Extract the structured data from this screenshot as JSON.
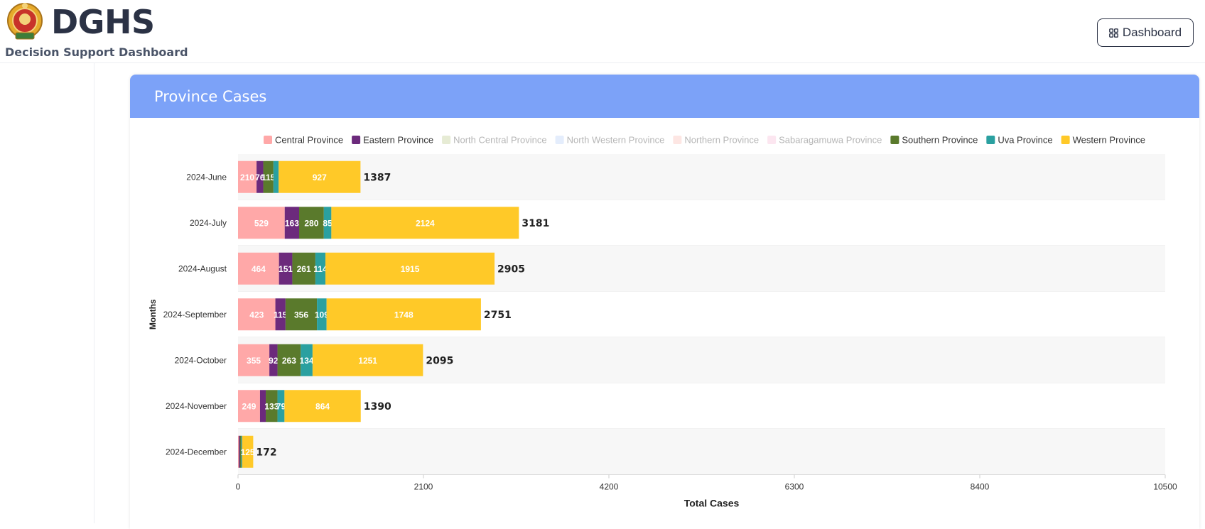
{
  "header": {
    "title": "DGHS",
    "subtitle": "Decision Support Dashboard",
    "dashboard_button": "Dashboard",
    "dashboard_icon": "grid-icon",
    "logo_icon": "emblem-logo"
  },
  "card": {
    "title": "Province Cases",
    "header_color": "#7ca2f8"
  },
  "chart_data": {
    "type": "bar",
    "orientation": "horizontal",
    "stacked": true,
    "xlabel": "Total Cases",
    "ylabel": "Months",
    "xlim": [
      0,
      10500
    ],
    "xticks": [
      0,
      2100,
      4200,
      6300,
      8400,
      10500
    ],
    "legend_position": "top",
    "categories": [
      "2024-June",
      "2024-July",
      "2024-August",
      "2024-September",
      "2024-October",
      "2024-November",
      "2024-December"
    ],
    "totals": [
      1387,
      3181,
      2905,
      2751,
      2095,
      1390,
      172
    ],
    "series": [
      {
        "name": "Central Province",
        "color": "#ffa8a8",
        "hidden": false,
        "values": [
          210,
          529,
          464,
          423,
          355,
          249,
          8
        ]
      },
      {
        "name": "Eastern Province",
        "color": "#6c2a7c",
        "hidden": false,
        "values": [
          76,
          163,
          151,
          115,
          92,
          65,
          14
        ]
      },
      {
        "name": "North Central Province",
        "color": "#e0e6c9",
        "hidden": true,
        "values": [
          0,
          0,
          0,
          0,
          0,
          0,
          0
        ]
      },
      {
        "name": "North Western Province",
        "color": "#dde8fb",
        "hidden": true,
        "values": [
          0,
          0,
          0,
          0,
          0,
          0,
          0
        ]
      },
      {
        "name": "Northern Province",
        "color": "#fde0dc",
        "hidden": true,
        "values": [
          0,
          0,
          0,
          0,
          0,
          0,
          0
        ]
      },
      {
        "name": "Sabaragamuwa Province",
        "color": "#fbe0ec",
        "hidden": true,
        "values": [
          0,
          0,
          0,
          0,
          0,
          0,
          0
        ]
      },
      {
        "name": "Southern Province",
        "color": "#5a7a2c",
        "hidden": false,
        "values": [
          115,
          280,
          261,
          356,
          263,
          133,
          15
        ]
      },
      {
        "name": "Uva Province",
        "color": "#2aa0a0",
        "hidden": false,
        "values": [
          59,
          85,
          114,
          109,
          134,
          79,
          10
        ]
      },
      {
        "name": "Western Province",
        "color": "#ffc928",
        "hidden": false,
        "values": [
          927,
          2124,
          1915,
          1748,
          1251,
          864,
          125
        ]
      }
    ]
  }
}
